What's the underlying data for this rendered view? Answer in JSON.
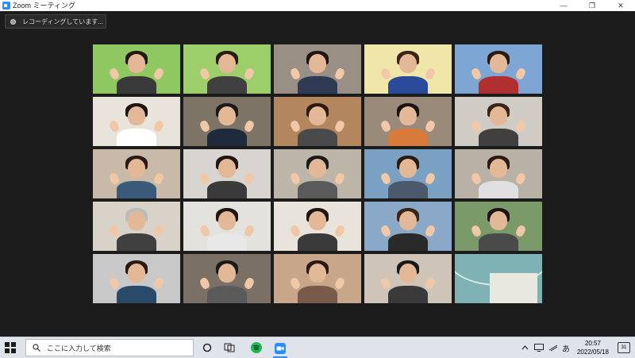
{
  "window": {
    "title": "Zoom ミーティング",
    "minimize_glyph": "—",
    "restore_glyph": "❐",
    "close_glyph": "✕"
  },
  "recording": {
    "label": "レコーディングしています..."
  },
  "participants": [
    {
      "bg": "#8fc860",
      "hair": "#221711",
      "shirt": "#3a3a3a"
    },
    {
      "bg": "#9ccf6a",
      "hair": "#2a1a12",
      "shirt": "#404040"
    },
    {
      "bg": "#9a8f84",
      "hair": "#1e1512",
      "shirt": "#2f3a55"
    },
    {
      "bg": "#efe6a8",
      "hair": "#3a2418",
      "shirt": "#2a4a9a"
    },
    {
      "bg": "#7ea6d4",
      "hair": "#2a1a12",
      "shirt": "#b03030"
    },
    {
      "bg": "#e8e4dc",
      "hair": "#1e1512",
      "shirt": "#ffffff"
    },
    {
      "bg": "#7d7466",
      "hair": "#1a1a1a",
      "shirt": "#1f2a3a"
    },
    {
      "bg": "#b4865e",
      "hair": "#2a1a12",
      "shirt": "#4a4a4a"
    },
    {
      "bg": "#9a8a7a",
      "hair": "#1a1210",
      "shirt": "#d87a3a"
    },
    {
      "bg": "#d0cbc4",
      "hair": "#3a2418",
      "shirt": "#404040"
    },
    {
      "bg": "#c9b9a8",
      "hair": "#2a1a12",
      "shirt": "#3a5a7a"
    },
    {
      "bg": "#d8d4cf",
      "hair": "#1e1512",
      "shirt": "#3a3a3a"
    },
    {
      "bg": "#bdb5a8",
      "hair": "#1a1a1a",
      "shirt": "#5a5a5a"
    },
    {
      "bg": "#7aa0c4",
      "hair": "#2a1a12",
      "shirt": "#4a5a6a"
    },
    {
      "bg": "#b9b1a5",
      "hair": "#2a1a12",
      "shirt": "#e0e0e0"
    },
    {
      "bg": "#d8d2c8",
      "hair": "#bbbbbb",
      "shirt": "#404040"
    },
    {
      "bg": "#e4e2dc",
      "hair": "#1e1512",
      "shirt": "#e8e8e8"
    },
    {
      "bg": "#e8e4dc",
      "hair": "#1e1512",
      "shirt": "#3a3a3a"
    },
    {
      "bg": "#8aa9c8",
      "hair": "#3a2418",
      "shirt": "#2a2a2a"
    },
    {
      "bg": "#7a9a6a",
      "hair": "#1e1512",
      "shirt": "#4a4a4a"
    },
    {
      "bg": "#c8c8c8",
      "hair": "#2a1a12",
      "shirt": "#2a4a6a"
    },
    {
      "bg": "#7a7066",
      "hair": "#1a1a1a",
      "shirt": "#5a5a5a"
    },
    {
      "bg": "#c7a68a",
      "hair": "#2a1a12",
      "shirt": "#7a5a4a"
    },
    {
      "bg": "#cfc4b8",
      "hair": "#1a1a1a",
      "shirt": "#3a3a3a"
    },
    {
      "bg": "#7fb2b4",
      "hair": "",
      "shirt": ""
    }
  ],
  "taskbar": {
    "search_placeholder": "ここに入力して検索",
    "ime": "あ",
    "time": "20:57",
    "date": "2022/05/18",
    "notifications": "31"
  }
}
